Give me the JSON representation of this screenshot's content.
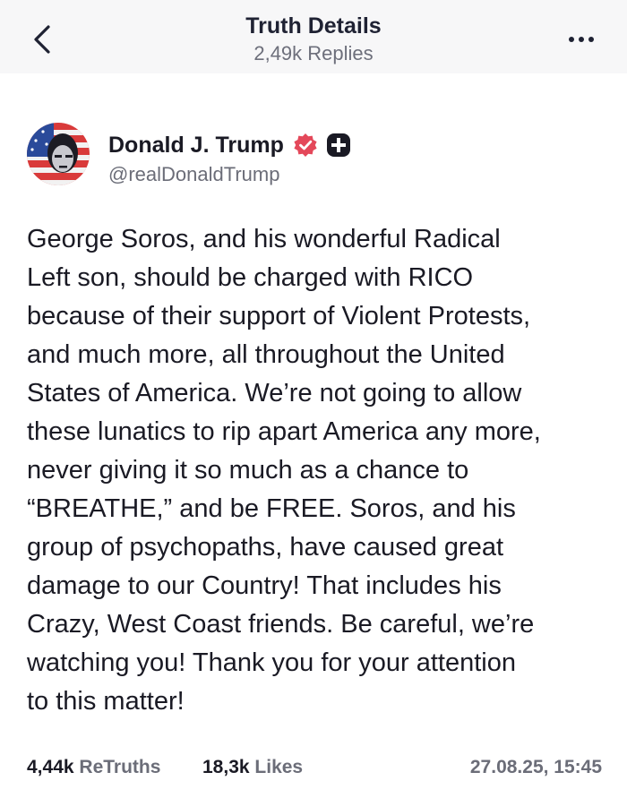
{
  "header": {
    "title": "Truth Details",
    "subtitle": "2,49k Replies",
    "back_icon": "chevron-left-icon",
    "more_icon": "ellipsis-horizontal-icon"
  },
  "author": {
    "name": "Donald J. Trump",
    "handle": "@realDonaldTrump",
    "verified_color": "#e4485a",
    "badge_icon": "plus-badge-icon"
  },
  "post": {
    "lines": [
      "George Soros, and his wonderful Radical",
      "Left son, should be charged with RICO",
      "because of their support of Violent Protests,",
      "and much more, all throughout the United",
      "States of America. We’re not going to allow",
      "these lunatics to rip apart America any more,",
      "never giving it so much as a chance to",
      "“BREATHE,” and be FREE. Soros, and his",
      "group of psychopaths, have caused great",
      "damage to our Country! That includes his",
      "Crazy, West Coast friends. Be careful, we’re",
      "watching you! Thank you for your attention",
      "to this matter!"
    ]
  },
  "stats": {
    "retruths_count": "4,44k",
    "retruths_label": "ReTruths",
    "likes_count": "18,3k",
    "likes_label": "Likes",
    "timestamp": "27.08.25, 15:45"
  }
}
